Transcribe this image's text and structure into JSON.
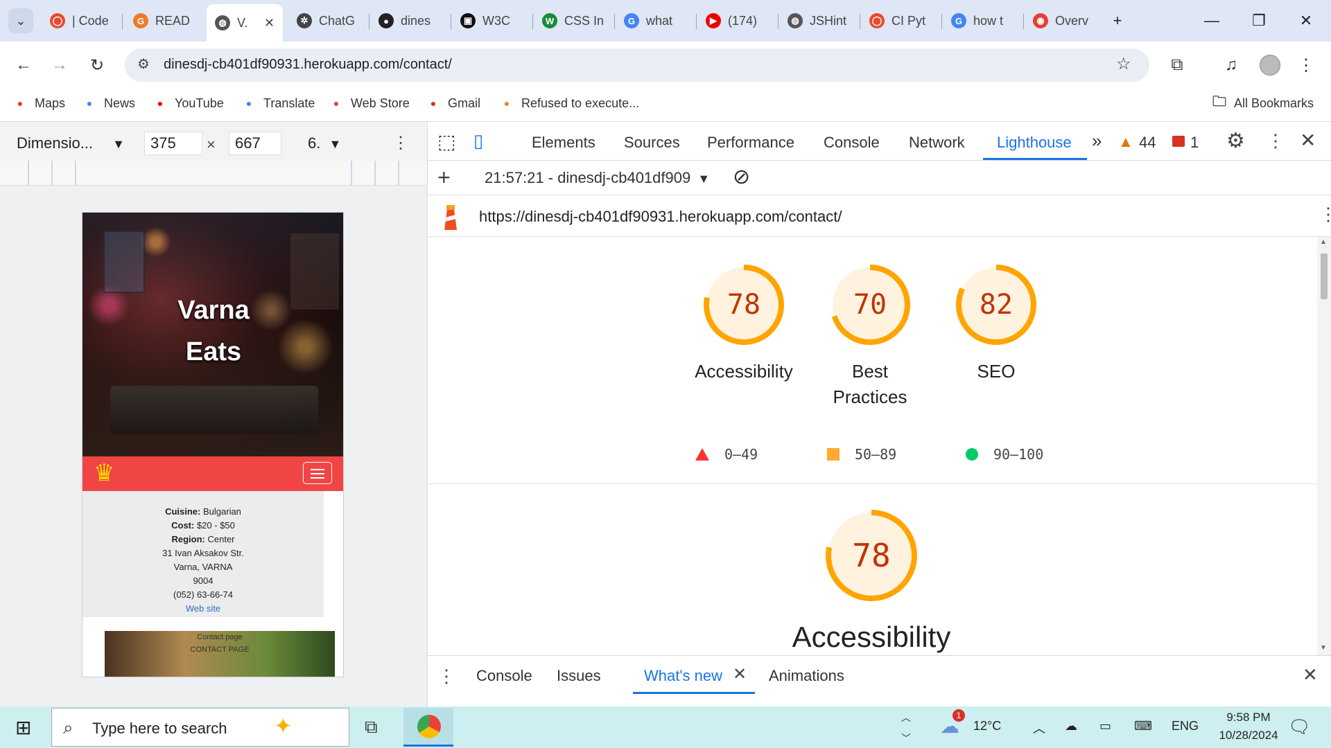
{
  "browser": {
    "tabs": [
      {
        "label": "| Code",
        "fav_color": "#e94a2e",
        "fav_char": "◯"
      },
      {
        "label": "READ",
        "fav_color": "#f07a2a",
        "fav_char": "G"
      },
      {
        "label": "V.",
        "fav_color": "#555",
        "fav_char": "◍"
      },
      {
        "label": "ChatG",
        "fav_color": "#444",
        "fav_char": "✲"
      },
      {
        "label": "dines",
        "fav_color": "#222",
        "fav_char": "●"
      },
      {
        "label": "W3C",
        "fav_color": "#111",
        "fav_char": "▣"
      },
      {
        "label": "CSS In",
        "fav_color": "#1a8a3a",
        "fav_char": "W"
      },
      {
        "label": "what",
        "fav_color": "#4285f4",
        "fav_char": "G"
      },
      {
        "label": "(174)",
        "fav_color": "#e00",
        "fav_char": "▶"
      },
      {
        "label": "JSHint",
        "fav_color": "#555",
        "fav_char": "◍"
      },
      {
        "label": "CI Pyt",
        "fav_color": "#e94a2e",
        "fav_char": "◯"
      },
      {
        "label": "how t",
        "fav_color": "#4285f4",
        "fav_char": "G"
      },
      {
        "label": "Overv",
        "fav_color": "#e34133",
        "fav_char": "◉"
      }
    ],
    "url": "dinesdj-cb401df90931.herokuapp.com/contact/",
    "bookmarks": [
      {
        "label": "Maps",
        "icon": "maps-icon",
        "color": "#e33"
      },
      {
        "label": "News",
        "icon": "news-icon",
        "color": "#4285f4"
      },
      {
        "label": "YouTube",
        "icon": "youtube-icon",
        "color": "#e00"
      },
      {
        "label": "Translate",
        "icon": "translate-icon",
        "color": "#4285f4"
      },
      {
        "label": "Web Store",
        "icon": "webstore-icon",
        "color": "#e34133"
      },
      {
        "label": "Gmail",
        "icon": "gmail-icon",
        "color": "#d93025"
      },
      {
        "label": "Refused to execute...",
        "icon": "stackoverflow-icon",
        "color": "#f48024"
      }
    ],
    "all_bookmarks": "All Bookmarks"
  },
  "device_toolbar": {
    "device": "Dimensio...",
    "width": "375",
    "height": "667",
    "zoom": "6.",
    "times": "×"
  },
  "site": {
    "title_line1": "Varna",
    "title_line2": "Eats",
    "info": {
      "cuisine_label": "Cuisine:",
      "cuisine": "Bulgarian",
      "cost_label": "Cost:",
      "cost": "$20 - $50",
      "region_label": "Region:",
      "region": "Center",
      "street": "31 Ivan Aksakov Str.",
      "city": "Varna, VARNA",
      "zip": "9004",
      "phone": "(052) 63-66-74",
      "website": "Web site"
    },
    "contact_line1": "Contact page",
    "contact_line2": "CONTACT PAGE"
  },
  "devtools": {
    "tabs": [
      "Elements",
      "Sources",
      "Performance",
      "Console",
      "Network",
      "Lighthouse"
    ],
    "active_tab": "Lighthouse",
    "more": "»",
    "warnings": "44",
    "errors": "1",
    "report_selector": "21:57:21 - dinesdj-cb401df909",
    "report_url": "https://dinesdj-cb401df90931.herokuapp.com/contact/",
    "scores": [
      {
        "value": 78,
        "label_line1": "Accessibility",
        "label_line2": ""
      },
      {
        "value": 70,
        "label_line1": "Best",
        "label_line2": "Practices"
      },
      {
        "value": 82,
        "label_line1": "SEO",
        "label_line2": ""
      }
    ],
    "legend": [
      {
        "range": "0–49",
        "color": "#f33",
        "shape": "triangle"
      },
      {
        "range": "50–89",
        "color": "#fa3",
        "shape": "square"
      },
      {
        "range": "90–100",
        "color": "#0c6",
        "shape": "circle"
      }
    ],
    "big_score": {
      "value": 78,
      "label": "Accessibility"
    },
    "drawer_tabs": [
      "Console",
      "Issues",
      "What's new",
      "Animations"
    ],
    "drawer_active": "What's new",
    "gauge_color": "#ffa400",
    "gauge_bg": "#fff3e0"
  },
  "taskbar": {
    "search_placeholder": "Type here to search",
    "weather": "12°C",
    "weather_badge": "1",
    "lang": "ENG",
    "time": "9:58 PM",
    "date": "10/28/2024"
  }
}
